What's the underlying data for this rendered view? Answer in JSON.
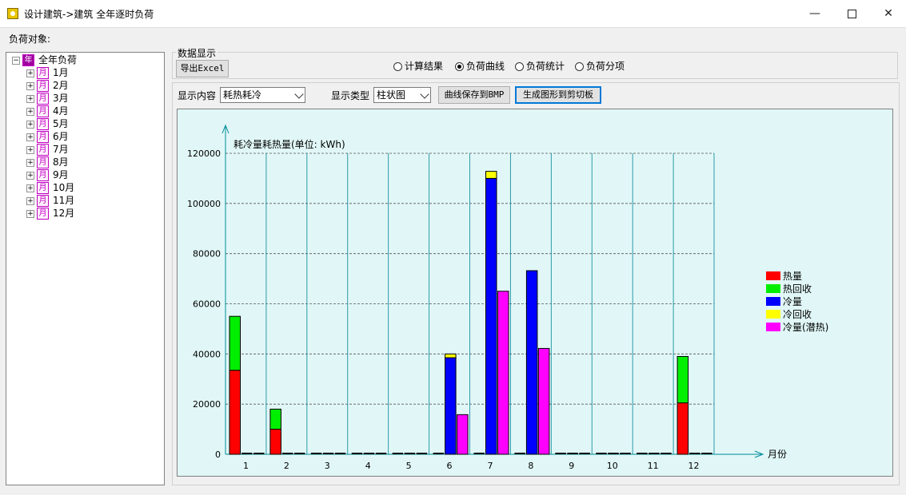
{
  "window": {
    "title": "设计建筑->建筑 全年逐时负荷",
    "minimize_glyph": "—",
    "close_glyph": "✕"
  },
  "left": {
    "load_object_label": "负荷对象:",
    "tree": {
      "root": {
        "label": "全年负荷",
        "icon": "年",
        "expander": "−"
      },
      "children_icon": "月",
      "children_expander": "+",
      "children": [
        "1月",
        "2月",
        "3月",
        "4月",
        "5月",
        "6月",
        "7月",
        "8月",
        "9月",
        "10月",
        "11月",
        "12月"
      ]
    }
  },
  "data_display": {
    "group_title": "数据显示",
    "export_button": "导出Excel",
    "radios": [
      {
        "label": "计算结果",
        "selected": false
      },
      {
        "label": "负荷曲线",
        "selected": true
      },
      {
        "label": "负荷统计",
        "selected": false
      },
      {
        "label": "负荷分项",
        "selected": false
      }
    ]
  },
  "controls": {
    "content_label": "显示内容",
    "content_value": "耗热耗冷",
    "type_label": "显示类型",
    "type_value": "柱状图",
    "save_bmp_button": "曲线保存到BMP",
    "clipboard_button": "生成图形到剪切板"
  },
  "chart_data": {
    "type": "bar",
    "ylabel": "耗冷量耗热量(单位: kWh)",
    "xlabel": "月份",
    "ylim": [
      0,
      120000
    ],
    "yticks": [
      0,
      20000,
      40000,
      60000,
      80000,
      100000,
      120000
    ],
    "categories": [
      "1",
      "2",
      "3",
      "4",
      "5",
      "6",
      "7",
      "8",
      "9",
      "10",
      "11",
      "12"
    ],
    "grid": "horizontal dashed + vertical separators",
    "legend_position": "right",
    "colors": {
      "热量": "#ff0000",
      "热回收": "#00ee00",
      "冷量": "#0000ff",
      "冷回收": "#ffff00",
      "冷量(潜热)": "#ff00ff",
      "background": "#e1f7f7",
      "axis": "#008b9a"
    },
    "bar_groups": [
      {
        "name": "heating_stack",
        "segments": [
          "热量",
          "热回收"
        ]
      },
      {
        "name": "cooling_stack",
        "segments": [
          "冷量",
          "冷回收"
        ]
      },
      {
        "name": "latent",
        "segments": [
          "冷量(潜热)"
        ]
      }
    ],
    "series": [
      {
        "name": "热量",
        "values": [
          33500,
          10000,
          0,
          0,
          0,
          0,
          0,
          0,
          0,
          0,
          0,
          20500
        ]
      },
      {
        "name": "热回收",
        "values": [
          21500,
          8000,
          0,
          0,
          0,
          0,
          0,
          0,
          0,
          0,
          0,
          18500
        ]
      },
      {
        "name": "冷量",
        "values": [
          0,
          0,
          0,
          0,
          0,
          38500,
          110000,
          73200,
          0,
          0,
          0,
          0
        ]
      },
      {
        "name": "冷回收",
        "values": [
          0,
          0,
          0,
          0,
          0,
          1500,
          2800,
          0,
          0,
          0,
          0,
          0
        ]
      },
      {
        "name": "冷量(潜热)",
        "values": [
          0,
          0,
          0,
          0,
          0,
          15800,
          65000,
          42200,
          0,
          0,
          0,
          0
        ]
      }
    ]
  }
}
